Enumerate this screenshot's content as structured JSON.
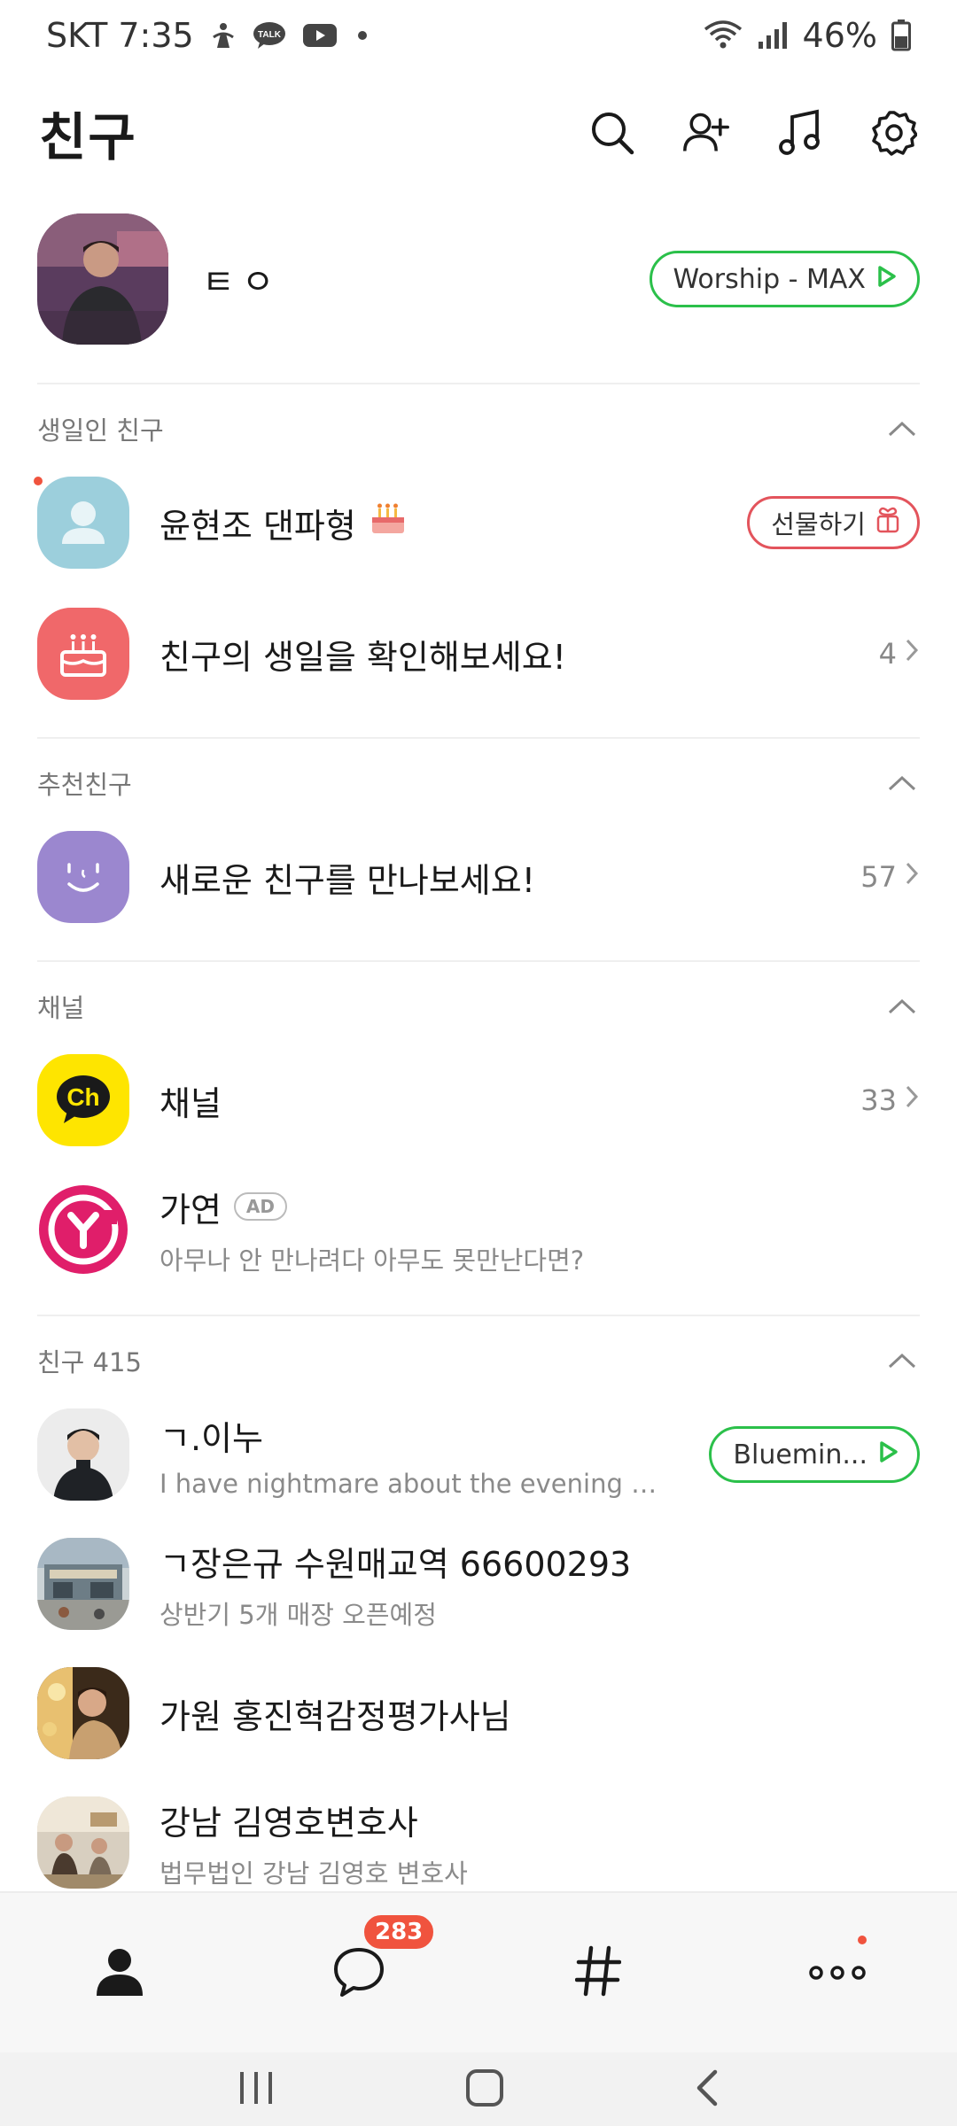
{
  "status_bar": {
    "carrier_time": "SKT 7:35",
    "battery": "46%",
    "icons": [
      "gesture-icon",
      "talk-bubble-icon",
      "youtube-icon",
      "dot-icon",
      "wifi-icon",
      "signal-icon",
      "battery-icon"
    ]
  },
  "header": {
    "title": "친구",
    "icons": [
      "search-icon",
      "add-friend-icon",
      "music-icon",
      "settings-icon"
    ]
  },
  "my_profile": {
    "name": "ㅌㅇ",
    "music": "Worship - MAX"
  },
  "sections": {
    "birthday": {
      "title": "생일인 친구",
      "friend_name": "윤현조 댄파형",
      "gift_button": "선물하기",
      "check_text": "친구의 생일을 확인해보세요!",
      "check_count": "4"
    },
    "recommended": {
      "title": "추천친구",
      "text": "새로운 친구를 만나보세요!",
      "count": "57"
    },
    "channel": {
      "title": "채널",
      "channel_label": "채널",
      "channel_count": "33",
      "ad_name": "가연",
      "ad_badge": "AD",
      "ad_sub": "아무나 안 만나려다 아무도 못만난다면?"
    },
    "friends": {
      "title": "친구 415",
      "items": [
        {
          "name": "ㄱ.이누",
          "sub": "I have nightmare about the evening pri...",
          "music": "Bluemin..."
        },
        {
          "name": "ㄱ장은규 수원매교역 66600293",
          "sub": "상반기 5개 매장 오픈예정"
        },
        {
          "name": "가원 홍진혁감정평가사님",
          "sub": ""
        },
        {
          "name": "강남 김영호변호사",
          "sub": "법무법인 강남 김영호 변호사"
        }
      ]
    }
  },
  "bottom_nav": {
    "items": [
      "friends-tab",
      "chats-tab",
      "open-chat-tab",
      "more-tab"
    ],
    "chat_badge": "283"
  },
  "colors": {
    "green": "#2bc04a",
    "red": "#e3545c",
    "badge": "#f0533e",
    "kakao_yellow": "#fee500"
  }
}
